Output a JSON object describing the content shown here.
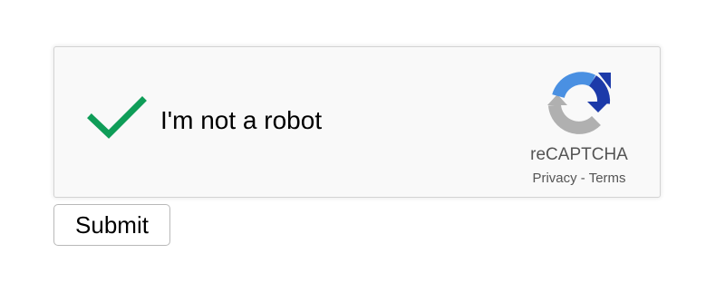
{
  "recaptcha": {
    "checked": true,
    "label": "I'm not a robot",
    "brand": "reCAPTCHA",
    "privacy_label": "Privacy",
    "separator": " - ",
    "terms_label": "Terms",
    "colors": {
      "checkmark": "#0f9d58",
      "box_background": "#f9f9f9",
      "box_border": "#d3d3d3",
      "logo_blue_dark": "#1c3aa9",
      "logo_blue_light": "#4a90e2",
      "logo_gray": "#b0b0b0"
    },
    "icons": {
      "check": "checkmark-icon",
      "logo": "recaptcha-logo-icon"
    }
  },
  "form": {
    "submit_label": "Submit"
  }
}
